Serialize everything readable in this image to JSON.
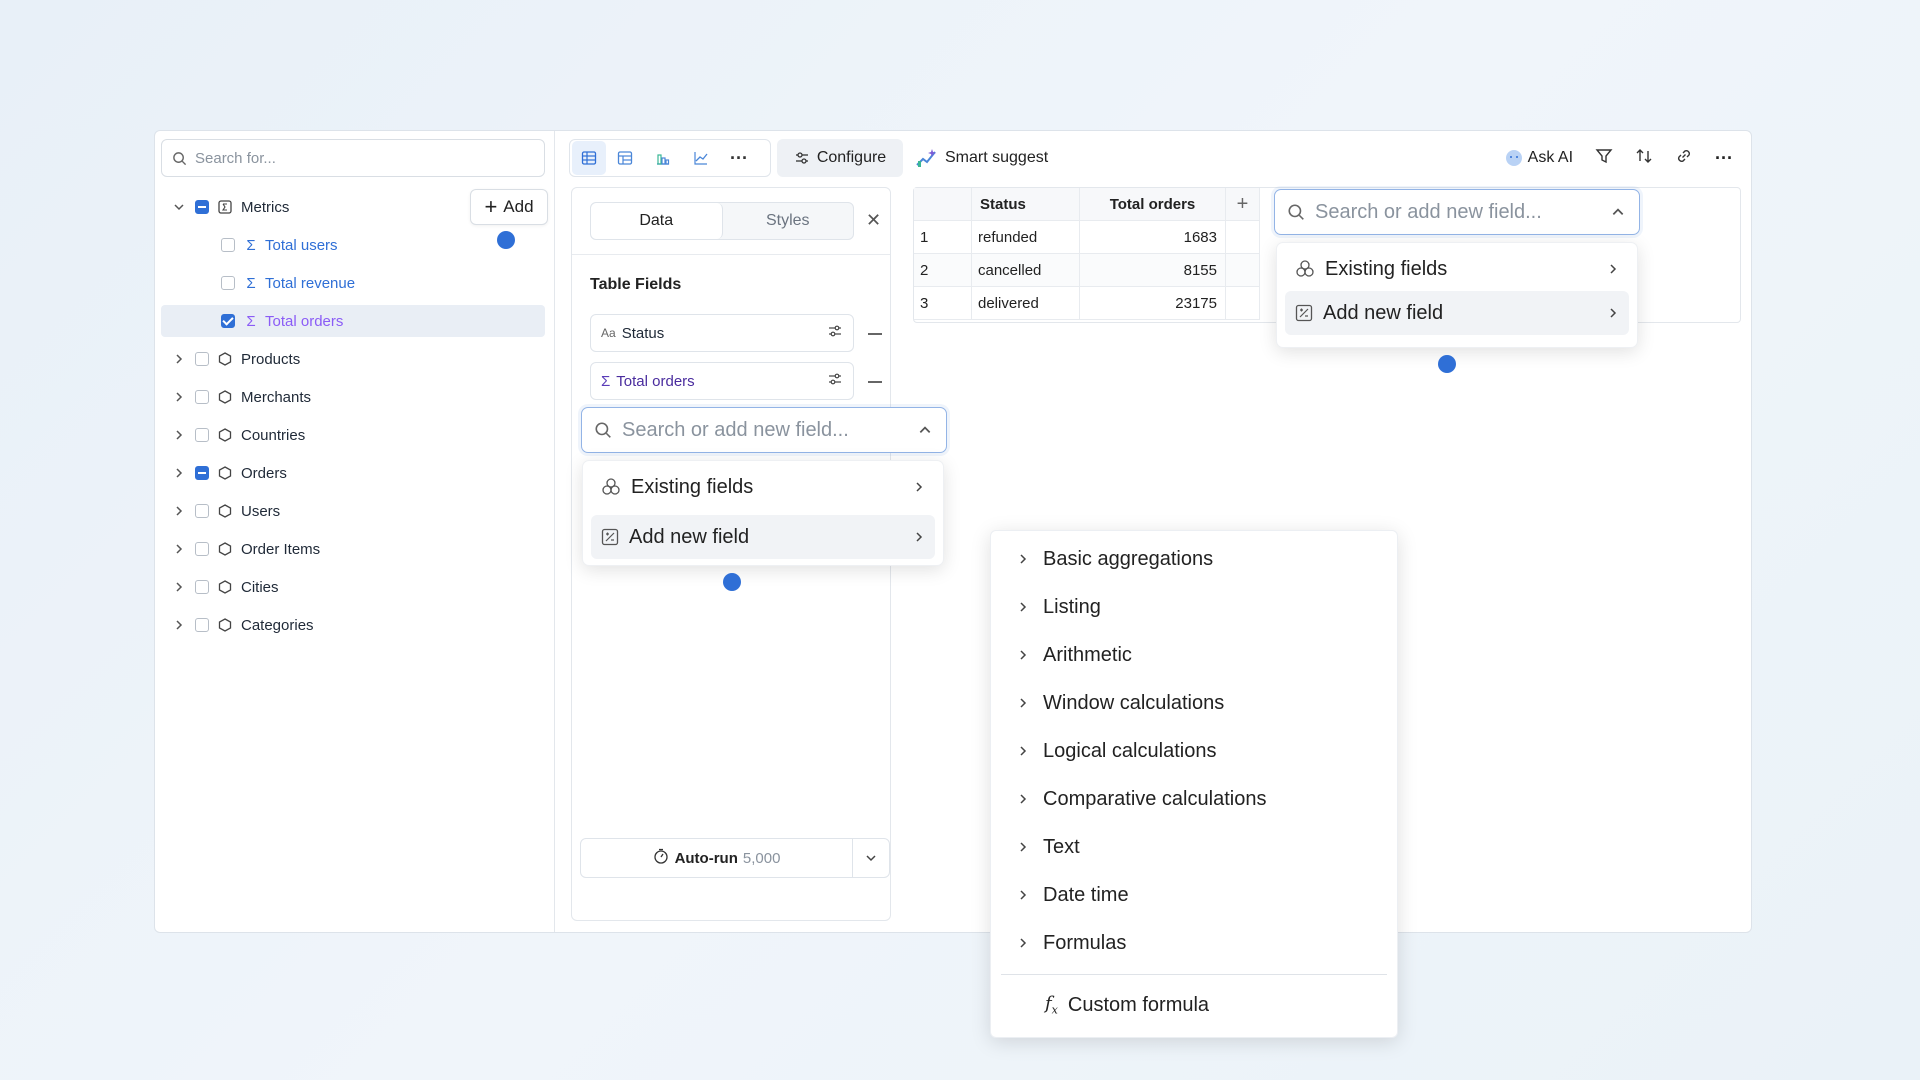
{
  "colors": {
    "accent": "#2f6fd6",
    "purple": "#8b5cf6"
  },
  "sidebar": {
    "search_placeholder": "Search for...",
    "add_label": "Add",
    "items": [
      {
        "label": "Metrics",
        "icon": "metrics-icon",
        "state": "partial",
        "expanded": true
      },
      {
        "label": "Total users",
        "icon": "sigma-icon",
        "state": "unchecked"
      },
      {
        "label": "Total revenue",
        "icon": "sigma-icon",
        "state": "unchecked"
      },
      {
        "label": "Total orders",
        "icon": "sigma-icon",
        "state": "checked",
        "selected": true
      },
      {
        "label": "Products",
        "icon": "hexagon-icon",
        "state": "unchecked"
      },
      {
        "label": "Merchants",
        "icon": "hexagon-icon",
        "state": "unchecked"
      },
      {
        "label": "Countries",
        "icon": "hexagon-icon",
        "state": "unchecked"
      },
      {
        "label": "Orders",
        "icon": "hexagon-icon",
        "state": "partial"
      },
      {
        "label": "Users",
        "icon": "hexagon-icon",
        "state": "unchecked"
      },
      {
        "label": "Order Items",
        "icon": "hexagon-icon",
        "state": "unchecked"
      },
      {
        "label": "Cities",
        "icon": "hexagon-icon",
        "state": "unchecked"
      },
      {
        "label": "Categories",
        "icon": "hexagon-icon",
        "state": "unchecked"
      }
    ]
  },
  "toolbar": {
    "configure_label": "Configure",
    "smart_suggest_label": "Smart suggest",
    "ask_ai_label": "Ask AI"
  },
  "config": {
    "tabs": [
      "Data",
      "Styles"
    ],
    "section_title": "Table Fields",
    "fields": [
      {
        "label": "Status",
        "icon": "text-type-icon"
      },
      {
        "label": "Total orders",
        "icon": "sigma-icon"
      }
    ],
    "search_placeholder": "Search or add new field...",
    "menu": [
      "Existing fields",
      "Add new field"
    ],
    "autorun_label": "Auto-run",
    "autorun_count": "5,000"
  },
  "table": {
    "headers": [
      "Status",
      "Total orders"
    ],
    "rows": [
      {
        "index": "1",
        "status": "refunded",
        "total": "1683"
      },
      {
        "index": "2",
        "status": "cancelled",
        "total": "8155"
      },
      {
        "index": "3",
        "status": "delivered",
        "total": "23175"
      }
    ]
  },
  "table_dropdown": {
    "search_placeholder": "Search or add new field...",
    "menu": [
      "Existing fields",
      "Add new field"
    ]
  },
  "formula_menu": {
    "items": [
      "Basic aggregations",
      "Listing",
      "Arithmetic",
      "Window calculations",
      "Logical calculations",
      "Comparative calculations",
      "Text",
      "Date time",
      "Formulas"
    ],
    "custom_label": "Custom formula"
  }
}
